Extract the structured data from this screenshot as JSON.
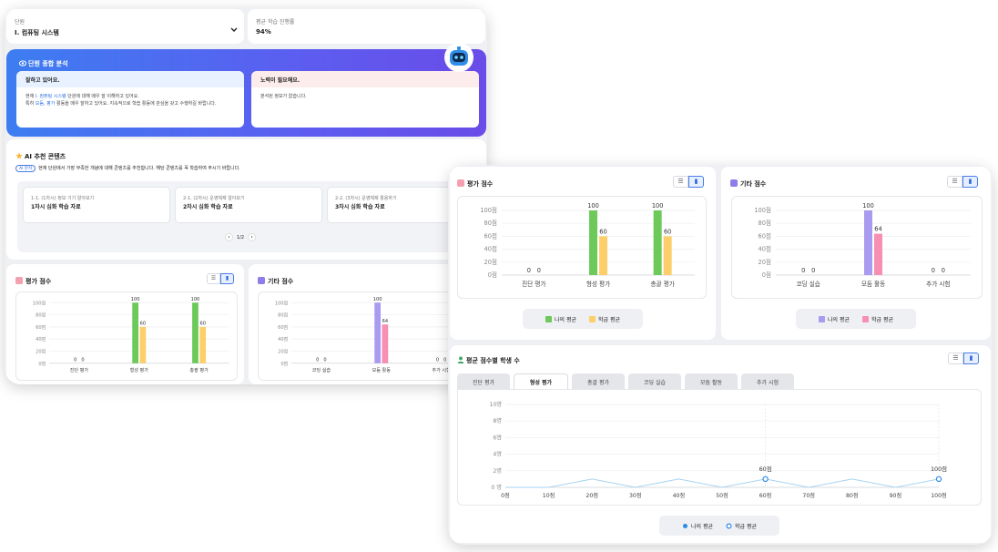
{
  "left_panel": {
    "unit_label": "단원",
    "unit_value": "I. 컴퓨팅 시스템",
    "progress_label": "평균 학습 진행률",
    "progress_value": "94%",
    "banner_title": "단원 종합 분석",
    "good_title": "잘하고 있어요.",
    "good_line1_a": "현재 ",
    "good_line1_b": "I. 컴퓨팅 시스템",
    "good_line1_c": " 단원에 대해 매우 잘 이해하고 있어요.",
    "good_line2_a": "특히 ",
    "good_line2_b": "모둠, 평가",
    "good_line2_c": " 활동을 매우 잘하고 있어요. 지속적으로 학습 활동에 관심을 갖고 수행하길 바랍니다.",
    "effort_title": "노력이 필요해요.",
    "effort_body": "분석된 정보가 없습니다.",
    "ai_title": "AI 추천 콘텐츠",
    "ai_badge": "AI 분석",
    "ai_desc": "현재 단원에서 가장 부족한 개념에 대해 콘텐츠를 추천합니다. 해당 콘텐츠를 꼭 학습하여 주시기 바랍니다.",
    "rec_items": [
      {
        "sub": "1-1. (1차시) 정보 기기 알아보기",
        "title": "1차시 심화 학습 자료"
      },
      {
        "sub": "2-1. (2차시) 운영체제 알아보기",
        "title": "2차시 심화 학습 자료"
      },
      {
        "sub": "2-2. (3차시) 운영체제 활용하기",
        "title": "3차시 심화 학습 자료"
      }
    ],
    "pagination": "1/2"
  },
  "eval_title": "평가 점수",
  "other_title": "기타 점수",
  "avg_title": "평균 점수별 학생 수",
  "legend": {
    "mine": "나의 평균",
    "class": "학급 평균"
  },
  "colors": {
    "green": "#6cc95a",
    "yellow": "#fccf6a",
    "purple": "#a99bef",
    "pink": "#f68fb1",
    "line": "#4aa3e8"
  },
  "bar_y_ticks": [
    "0점",
    "20점",
    "40점",
    "60점",
    "80점",
    "100점"
  ],
  "chart_data": [
    {
      "type": "bar",
      "title": "평가 점수",
      "categories": [
        "진단 평가",
        "형성 평가",
        "총괄 평가"
      ],
      "series": [
        {
          "name": "나의 평균",
          "values": [
            0,
            100,
            100
          ]
        },
        {
          "name": "학급 평균",
          "values": [
            0,
            60,
            60
          ]
        }
      ],
      "ylim": [
        0,
        100
      ]
    },
    {
      "type": "bar",
      "title": "기타 점수",
      "categories": [
        "코딩 실습",
        "모둠 활동",
        "추가 시험"
      ],
      "series": [
        {
          "name": "나의 평균",
          "values": [
            0,
            100,
            0
          ]
        },
        {
          "name": "학급 평균",
          "values": [
            0,
            64,
            0
          ]
        }
      ],
      "ylim": [
        0,
        100
      ]
    },
    {
      "type": "line",
      "title": "평균 점수별 학생 수",
      "x": [
        "0점",
        "10점",
        "20점",
        "30점",
        "40점",
        "50점",
        "60점",
        "70점",
        "80점",
        "90점",
        "100점"
      ],
      "y_ticks": [
        "0 명",
        "2명",
        "4명",
        "6명",
        "8명",
        "10명"
      ],
      "series": [
        {
          "name": "학급 평균",
          "values": [
            0,
            0,
            1,
            0,
            1,
            0,
            1,
            0,
            1,
            0,
            1
          ]
        }
      ],
      "marked_points": [
        {
          "x": "60점",
          "label": "60점"
        },
        {
          "x": "100점",
          "label": "100점"
        }
      ],
      "ylim": [
        0,
        10
      ]
    }
  ],
  "tabs": [
    "진단 평가",
    "형성 평가",
    "총괄 평가",
    "코딩 실습",
    "모둠 활동",
    "추가 시험"
  ],
  "active_tab": 1
}
